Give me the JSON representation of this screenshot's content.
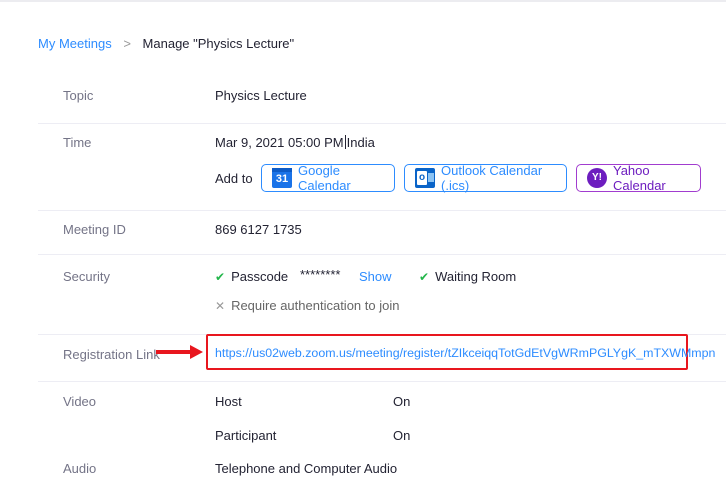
{
  "breadcrumb": {
    "parent": "My Meetings",
    "separator": ">",
    "current": "Manage \"Physics Lecture\""
  },
  "topic": {
    "label": "Topic",
    "value": "Physics Lecture"
  },
  "time": {
    "label": "Time",
    "value_prefix": "Mar 9, 2021 05:00 PM",
    "value_suffix": "India",
    "add_to_label": "Add to",
    "calendars": [
      {
        "name": "Google Calendar",
        "icon": "google-calendar-icon",
        "icon_text": "31"
      },
      {
        "name": "Outlook Calendar (.ics)",
        "icon": "outlook-calendar-icon",
        "icon_text": "o"
      },
      {
        "name": "Yahoo Calendar",
        "icon": "yahoo-calendar-icon",
        "icon_text": "Y!"
      }
    ]
  },
  "meeting_id": {
    "label": "Meeting ID",
    "value": "869 6127 1735"
  },
  "security": {
    "label": "Security",
    "passcode_label": "Passcode",
    "passcode_value": "********",
    "show_label": "Show",
    "waiting_room_label": "Waiting Room",
    "require_auth_label": "Require authentication to join",
    "check_glyph": "✔",
    "cross_glyph": "✕"
  },
  "registration": {
    "label": "Registration Link",
    "url": "https://us02web.zoom.us/meeting/register/tZIkceiqqTotGdEtVgWRmPGLYgK_mTXWMmpn"
  },
  "video": {
    "label": "Video",
    "host_label": "Host",
    "host_value": "On",
    "participant_label": "Participant",
    "participant_value": "On"
  },
  "audio": {
    "label": "Audio",
    "value": "Telephone and Computer Audio"
  },
  "colors": {
    "link_blue": "#2d8cff",
    "annotation_red": "#e8161e",
    "yahoo_purple": "#6d1dbf",
    "check_green": "#23b64b"
  }
}
